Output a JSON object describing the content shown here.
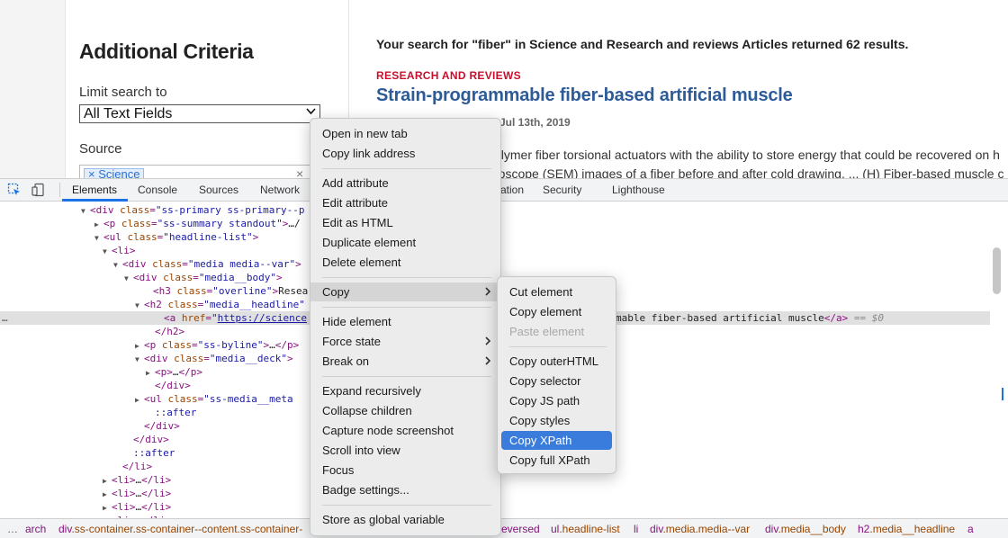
{
  "site": {
    "criteria": {
      "heading": "Additional Criteria",
      "limit_label": "Limit search to",
      "limit_value": "All Text Fields",
      "source_label": "Source",
      "source_tag": "Science",
      "tag_remove": "×",
      "clear": "×"
    },
    "results": {
      "summary": "Your search for \"fiber\" in Science and Research and reviews Articles returned 62 results.",
      "overline": "RESEARCH AND REVIEWS",
      "title": "Strain-programmable fiber-based artificial muscle",
      "byline": "Jul 13th, 2019",
      "deck_line1": "olymer fiber torsional actuators with the ability to store energy that could be recovered on h",
      "deck_line2": "roscope (SEM) images of a fiber before and after cold drawing. ... (H) Fiber-based muscle c"
    }
  },
  "devtools": {
    "tabs": [
      "Elements",
      "Console",
      "Sources",
      "Network",
      "ation",
      "Security",
      "Lighthouse"
    ],
    "active_tab": "Elements",
    "dom_rows": [
      {
        "indent": 100,
        "tri": "▼",
        "html": "<div class=\"ss-primary ss-primary--p"
      },
      {
        "indent": 115,
        "tri": "▶",
        "html": "<p class=\"ss-summary standout\">…</"
      },
      {
        "indent": 115,
        "tri": "▼",
        "html": "<ul class=\"headline-list\">"
      },
      {
        "indent": 124,
        "tri": "▼",
        "html": "<li>"
      },
      {
        "indent": 136,
        "tri": "▼",
        "html": "<div class=\"media media--var\">"
      },
      {
        "indent": 148,
        "tri": "▼",
        "html": "<div class=\"media__body\">"
      },
      {
        "indent": 170,
        "tri": "",
        "html": "<h3 class=\"overline\">Resea"
      },
      {
        "indent": 160,
        "tri": "▼",
        "html": "<h2 class=\"media__headline\""
      },
      {
        "indent": 182,
        "tri": "",
        "html": "<a href=\"https://science"
      },
      {
        "indent": 172,
        "tri": "",
        "html": "</h2>"
      },
      {
        "indent": 160,
        "tri": "▶",
        "html": "<p class=\"ss-byline\">…</p>"
      },
      {
        "indent": 160,
        "tri": "▼",
        "html": "<div class=\"media__deck\">"
      },
      {
        "indent": 172,
        "tri": "▶",
        "html": "<p>…</p>"
      },
      {
        "indent": 172,
        "tri": "",
        "html": "</div>"
      },
      {
        "indent": 160,
        "tri": "▶",
        "html": "<ul class=\"ss-media__meta"
      },
      {
        "indent": 172,
        "tri": "",
        "html": "::after"
      },
      {
        "indent": 160,
        "tri": "",
        "html": "</div>"
      },
      {
        "indent": 148,
        "tri": "",
        "html": "</div>"
      },
      {
        "indent": 148,
        "tri": "",
        "html": "::after"
      },
      {
        "indent": 136,
        "tri": "",
        "html": "</li>"
      },
      {
        "indent": 124,
        "tri": "▶",
        "html": "<li>…</li>"
      },
      {
        "indent": 124,
        "tri": "▶",
        "html": "<li>…</li>"
      },
      {
        "indent": 124,
        "tri": "▶",
        "html": "<li>…</li>"
      },
      {
        "indent": 124,
        "tri": "▶",
        "html": "<li>…</li>"
      }
    ],
    "selected_row_tail": "mable fiber-based artificial muscle</a> == $0",
    "breadcrumbs": [
      "arch",
      "div.ss-container.ss-container--content.ss-container-",
      "eversed",
      "ul.headline-list",
      "li",
      "div.media.media--var",
      "div.media__body",
      "h2.media__headline",
      "a"
    ],
    "dots": "…"
  },
  "context_menu": {
    "items": [
      {
        "label": "Open in new tab"
      },
      {
        "label": "Copy link address"
      },
      {
        "sep": true
      },
      {
        "label": "Add attribute"
      },
      {
        "label": "Edit attribute"
      },
      {
        "label": "Edit as HTML"
      },
      {
        "label": "Duplicate element"
      },
      {
        "label": "Delete element"
      },
      {
        "sep": true
      },
      {
        "label": "Copy",
        "submenu": true,
        "hover": true
      },
      {
        "sep": true
      },
      {
        "label": "Hide element"
      },
      {
        "label": "Force state",
        "submenu": true
      },
      {
        "label": "Break on",
        "submenu": true
      },
      {
        "sep": true
      },
      {
        "label": "Expand recursively"
      },
      {
        "label": "Collapse children"
      },
      {
        "label": "Capture node screenshot"
      },
      {
        "label": "Scroll into view"
      },
      {
        "label": "Focus"
      },
      {
        "label": "Badge settings..."
      },
      {
        "sep": true
      },
      {
        "label": "Store as global variable"
      }
    ]
  },
  "copy_submenu": {
    "items": [
      {
        "label": "Cut element"
      },
      {
        "label": "Copy element"
      },
      {
        "label": "Paste element",
        "disabled": true
      },
      {
        "sep": true
      },
      {
        "label": "Copy outerHTML"
      },
      {
        "label": "Copy selector"
      },
      {
        "label": "Copy JS path"
      },
      {
        "label": "Copy styles"
      },
      {
        "label": "Copy XPath",
        "active": true
      },
      {
        "label": "Copy full XPath"
      }
    ]
  },
  "colors": {
    "accent": "#3a7cdb",
    "overline": "#c8102e",
    "headline": "#2d5b98",
    "tag_name": "#881280",
    "attr_name": "#994500",
    "attr_value": "#1a1aa6"
  }
}
